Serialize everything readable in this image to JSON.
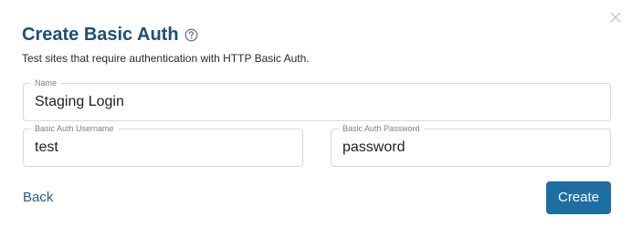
{
  "dialog": {
    "title": "Create Basic Auth",
    "subtitle": "Test sites that require authentication with HTTP Basic Auth.",
    "close_icon": "close-icon",
    "help_icon": "help-circle-icon"
  },
  "form": {
    "name": {
      "label": "Name",
      "value": "Staging Login"
    },
    "username": {
      "label": "Basic Auth Username",
      "value": "test"
    },
    "password": {
      "label": "Basic Auth Password",
      "value": "password"
    }
  },
  "actions": {
    "back_label": "Back",
    "create_label": "Create"
  },
  "colors": {
    "title": "#1e4f74",
    "primary_button": "#1d6fa3",
    "link": "#235f8e",
    "border": "#d5dadf"
  }
}
